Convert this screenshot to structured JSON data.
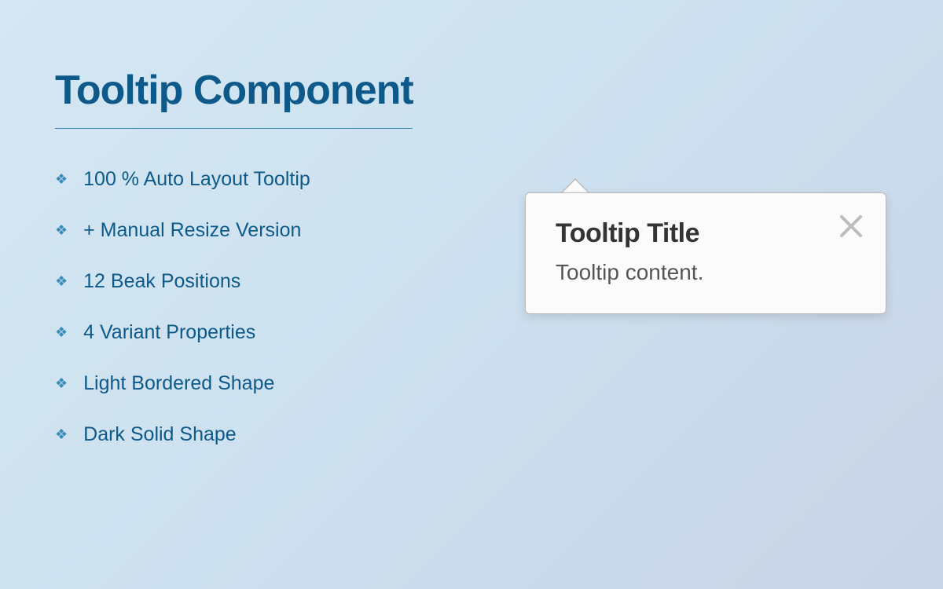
{
  "header": {
    "title": "Tooltip Component"
  },
  "features": {
    "items": [
      {
        "label": "100 % Auto Layout Tooltip"
      },
      {
        "label": "+ Manual Resize Version"
      },
      {
        "label": "12 Beak Positions"
      },
      {
        "label": "4 Variant Properties"
      },
      {
        "label": "Light Bordered Shape"
      },
      {
        "label": "Dark Solid Shape"
      }
    ]
  },
  "tooltip": {
    "title": "Tooltip Title",
    "content": "Tooltip content."
  }
}
